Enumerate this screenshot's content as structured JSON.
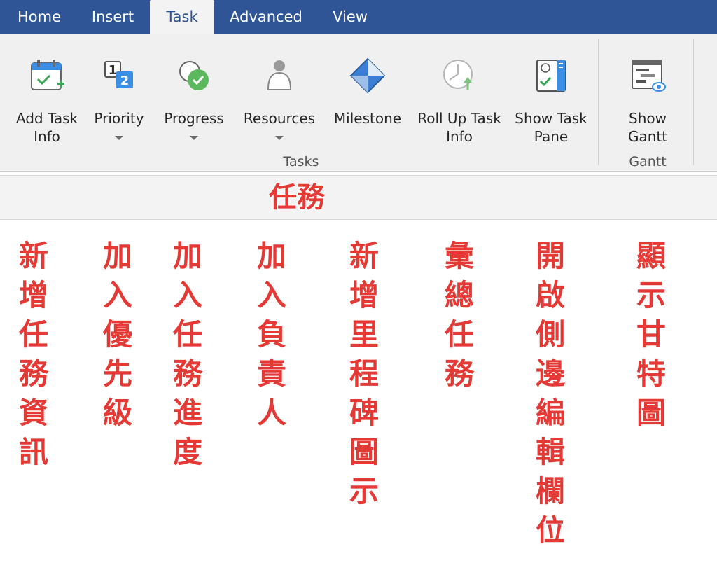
{
  "tabs": [
    {
      "label": "Home",
      "active": false
    },
    {
      "label": "Insert",
      "active": false
    },
    {
      "label": "Task",
      "active": true
    },
    {
      "label": "Advanced",
      "active": false
    },
    {
      "label": "View",
      "active": false
    }
  ],
  "ribbon": {
    "buttons": [
      {
        "label": "Add Task\nInfo",
        "icon": "add-task-calendar-icon",
        "dropdown": false
      },
      {
        "label": "Priority",
        "icon": "priority-12-icon",
        "dropdown": true
      },
      {
        "label": "Progress",
        "icon": "progress-check-icon",
        "dropdown": true
      },
      {
        "label": "Resources",
        "icon": "person-icon",
        "dropdown": true
      },
      {
        "label": "Milestone",
        "icon": "milestone-diamond-icon",
        "dropdown": false
      },
      {
        "label": "Roll Up Task\nInfo",
        "icon": "roll-up-clock-icon",
        "dropdown": false
      },
      {
        "label": "Show Task\nPane",
        "icon": "task-pane-icon",
        "dropdown": false
      },
      {
        "label": "Show\nGantt",
        "icon": "gantt-icon",
        "dropdown": false
      }
    ],
    "groups": {
      "tasks": "Tasks",
      "gantt": "Gantt"
    }
  },
  "annotations": {
    "section_title": "任務",
    "columns": [
      "新增任務資訊",
      "加入優先級",
      "加入任務進度",
      "加入負責人",
      "新增里程碑圖示",
      "彙總任務",
      "開啟側邊編輯欄位",
      "顯示甘特圖"
    ],
    "color": "#e53935"
  },
  "colors": {
    "tabbar": "#2f5597",
    "ribbon": "#f0f0f0"
  }
}
